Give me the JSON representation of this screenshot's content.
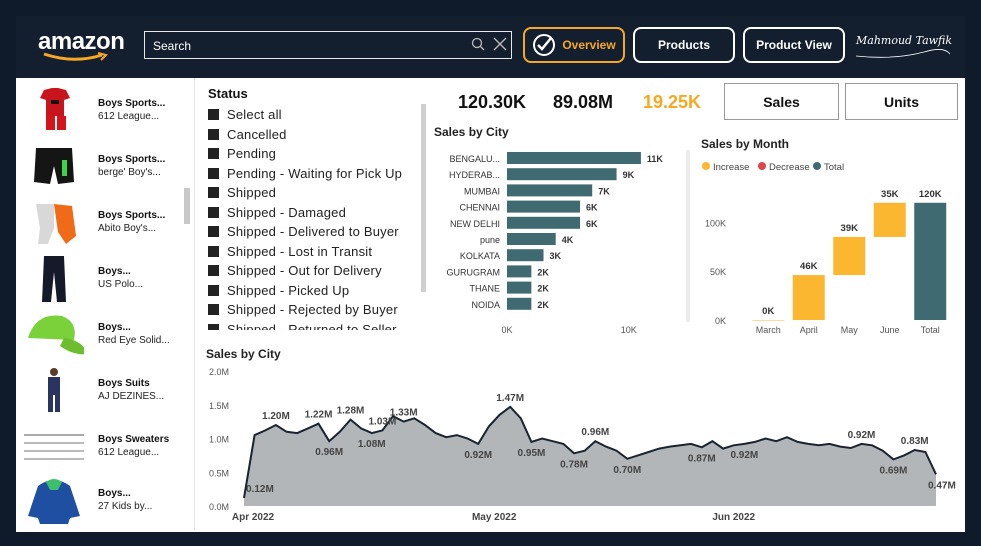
{
  "header": {
    "logo": "amazon",
    "search": {
      "placeholder": "Search"
    },
    "nav": {
      "overview": "Overview",
      "products": "Products",
      "product_view": "Product View"
    },
    "signature": "Mahmoud Tawfik"
  },
  "products": [
    {
      "title": "Boys Sports...",
      "sub": "612 League..."
    },
    {
      "title": "Boys Sports...",
      "sub": "berge' Boy's..."
    },
    {
      "title": "Boys Sports...",
      "sub": "Abito Boy's..."
    },
    {
      "title": "Boys...",
      "sub": "US Polo..."
    },
    {
      "title": "Boys...",
      "sub": "Red Eye Solid..."
    },
    {
      "title": "Boys Suits",
      "sub": "AJ DEZINES..."
    },
    {
      "title": "Boys Sweaters",
      "sub": "612 League..."
    },
    {
      "title": "Boys...",
      "sub": "27 Kids by..."
    }
  ],
  "status": {
    "title": "Status",
    "items": [
      "Select all",
      "Cancelled",
      "Pending",
      "Pending - Waiting for Pick Up",
      "Shipped",
      "Shipped - Damaged",
      "Shipped - Delivered to Buyer",
      "Shipped - Lost in Transit",
      "Shipped - Out for Delivery",
      "Shipped - Picked Up",
      "Shipped - Rejected by Buyer",
      "Shipped - Returned to Seller"
    ]
  },
  "kpis": {
    "sales": "120.30K",
    "amount": "89.08M",
    "units": "19.25K"
  },
  "toggles": {
    "sales": "Sales",
    "units": "Units"
  },
  "colors": {
    "accent": "#f7a823",
    "bar": "#3f6a72",
    "increase": "#fbb730",
    "decrease": "#e0454f",
    "total": "#3f6a72",
    "area": "#b2b6b9"
  },
  "chart_data": [
    {
      "type": "bar",
      "title": "Sales by City",
      "categories": [
        "BENGALU...",
        "HYDERAB...",
        "MUMBAI",
        "CHENNAI",
        "NEW DELHI",
        "pune",
        "KOLKATA",
        "GURUGRAM",
        "THANE",
        "NOIDA"
      ],
      "values": [
        11000,
        9000,
        7000,
        6000,
        6000,
        4000,
        3000,
        2000,
        2000,
        2000
      ],
      "labels": [
        "11K",
        "9K",
        "7K",
        "6K",
        "6K",
        "4K",
        "3K",
        "2K",
        "2K",
        "2K"
      ],
      "xticks": [
        "0K",
        "10K"
      ],
      "xlim": [
        0,
        11500
      ]
    },
    {
      "type": "waterfall",
      "title": "Sales by Month",
      "legend": [
        "Increase",
        "Decrease",
        "Total"
      ],
      "categories": [
        "March",
        "April",
        "May",
        "June",
        "Total"
      ],
      "values": [
        0,
        46000,
        39000,
        35000,
        120000
      ],
      "labels": [
        "0K",
        "46K",
        "39K",
        "35K",
        "120K"
      ],
      "yticks": [
        "0K",
        "50K",
        "100K"
      ],
      "ylim": [
        0,
        130000
      ]
    },
    {
      "type": "area",
      "title": "Sales by City",
      "yticks": [
        "0.0M",
        "0.5M",
        "1.0M",
        "1.5M",
        "2.0M"
      ],
      "ylim": [
        0,
        2.0
      ],
      "xticks": [
        "Apr 2022",
        "May 2022",
        "Jun 2022"
      ],
      "values": [
        0.12,
        1.05,
        1.12,
        1.2,
        1.1,
        1.08,
        1.15,
        1.22,
        0.96,
        1.1,
        1.28,
        1.15,
        1.08,
        1.12,
        1.33,
        1.25,
        1.3,
        1.2,
        1.08,
        1.02,
        1.05,
        1.0,
        0.92,
        1.18,
        1.35,
        1.47,
        1.3,
        0.95,
        1.0,
        0.96,
        0.92,
        0.78,
        0.82,
        0.96,
        0.88,
        0.82,
        0.7,
        0.75,
        0.8,
        0.85,
        0.88,
        0.9,
        0.92,
        0.87,
        0.96,
        0.85,
        0.9,
        0.92,
        0.95,
        1.0,
        0.96,
        1.02,
        0.95,
        0.92,
        0.9,
        0.92,
        0.88,
        0.86,
        0.92,
        0.9,
        0.82,
        0.69,
        0.75,
        0.83,
        0.8,
        0.47
      ],
      "labels": [
        {
          "i": 0,
          "text": "0.12M"
        },
        {
          "i": 3,
          "text": "1.20M"
        },
        {
          "i": 7,
          "text": "1.22M"
        },
        {
          "i": 8,
          "text": "0.96M"
        },
        {
          "i": 10,
          "text": "1.28M"
        },
        {
          "i": 12,
          "text": "1.08M"
        },
        {
          "i": 13,
          "text": "1.03M"
        },
        {
          "i": 15,
          "text": "1.33M"
        },
        {
          "i": 22,
          "text": "0.92M"
        },
        {
          "i": 25,
          "text": "1.47M"
        },
        {
          "i": 27,
          "text": "0.95M"
        },
        {
          "i": 31,
          "text": "0.78M"
        },
        {
          "i": 33,
          "text": "0.96M"
        },
        {
          "i": 36,
          "text": "0.70M"
        },
        {
          "i": 43,
          "text": "0.87M"
        },
        {
          "i": 47,
          "text": "0.92M"
        },
        {
          "i": 58,
          "text": "0.92M"
        },
        {
          "i": 61,
          "text": "0.69M"
        },
        {
          "i": 63,
          "text": "0.83M"
        },
        {
          "i": 65,
          "text": "0.47M"
        }
      ]
    }
  ]
}
